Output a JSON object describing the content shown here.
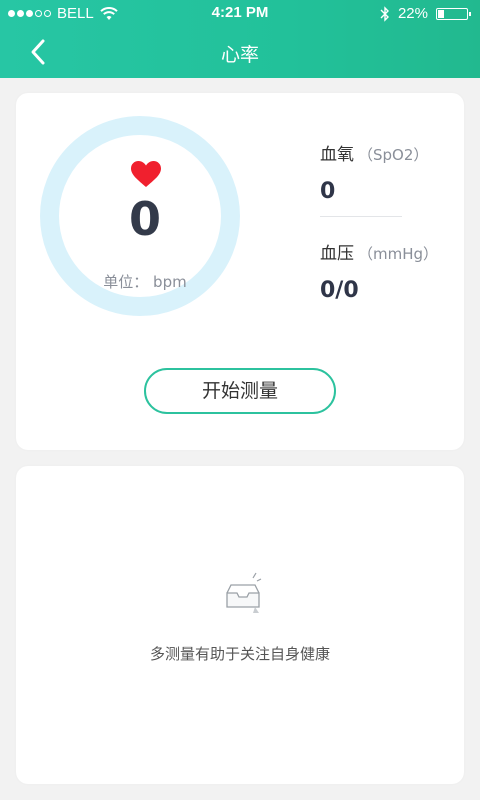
{
  "status_bar": {
    "carrier": "BELL",
    "time": "4:21 PM",
    "battery_text": "22%",
    "battery_level": 0.22,
    "signal_strength": 3
  },
  "nav": {
    "title": "心率",
    "back_icon": "chevron-left-icon"
  },
  "measure": {
    "heart_rate": {
      "value": "0",
      "unit_label": "单位： bpm"
    },
    "spo2": {
      "label": "血氧",
      "sub_label": "（SpO2）",
      "value": "0"
    },
    "blood_pressure": {
      "label": "血压",
      "sub_label": "（mmHg）",
      "value": "0/0"
    },
    "start_button_label": "开始测量"
  },
  "history": {
    "empty_message": "多测量有助于关注自身健康",
    "empty_icon": "empty-inbox-icon"
  },
  "colors": {
    "header_green": "#22c19a",
    "ring": "#d9f2fb",
    "heart": "#f0202e",
    "button_border": "#2cc29e"
  }
}
